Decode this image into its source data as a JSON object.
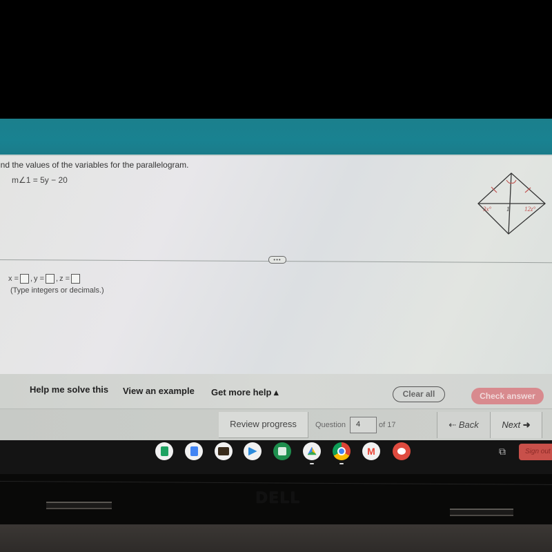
{
  "problem": {
    "instruction": "Find the values of the variables for the parallelogram.",
    "instruction_visible": "ind the values of the variables for the parallelogram.",
    "given": "m∠1 = 5y − 20",
    "figure": {
      "shape": "rhombus",
      "angle_labels": [
        "3x°",
        "1",
        "12z°"
      ],
      "label_color": "#c0504d"
    }
  },
  "answer": {
    "x_label": "x =",
    "y_label": "y =",
    "z_label": "z =",
    "separator": ",",
    "x_value": "",
    "y_value": "",
    "z_value": "",
    "hint": "(Type integers or decimals.)"
  },
  "divider": {
    "handle_label": "•••"
  },
  "help": {
    "help_me_solve": "Help me solve this",
    "view_example": "View an example",
    "get_more_help": "Get more help ▴",
    "clear_all": "Clear all",
    "check_answer": "Check answer"
  },
  "footer": {
    "review_progress": "Review progress",
    "question_label": "Question",
    "question_number": "4",
    "question_total": "of 17",
    "back_arrow": "🡐",
    "back_label": "Back",
    "next_label": "Next",
    "next_arrow": "➔"
  },
  "shelf": {
    "apps": [
      {
        "name": "google-sheets",
        "bg": "#f1f1f1",
        "color": "#1ea362"
      },
      {
        "name": "google-docs",
        "bg": "#f1f1f1",
        "color": "#4285f4"
      },
      {
        "name": "kindle",
        "bg": "#f1f1f1",
        "color": "#3a2c1c"
      },
      {
        "name": "screencastify",
        "bg": "#f1f1f1",
        "color": "#2d8cdc"
      },
      {
        "name": "calculator",
        "bg": "#1e8f4e",
        "color": "#ffffff"
      },
      {
        "name": "google-drive",
        "bg": "#f1f1f1",
        "color": "#fbbc04"
      },
      {
        "name": "chrome",
        "bg": "#f1f1f1",
        "color": "#db4437"
      },
      {
        "name": "gmail",
        "bg": "#f1f1f1",
        "color": "#ea4335"
      },
      {
        "name": "canvas-paint",
        "bg": "#e04b3f",
        "color": "#ffffff"
      }
    ],
    "sign_out": "Sign out"
  },
  "bezel": {
    "brand": "DELL"
  }
}
